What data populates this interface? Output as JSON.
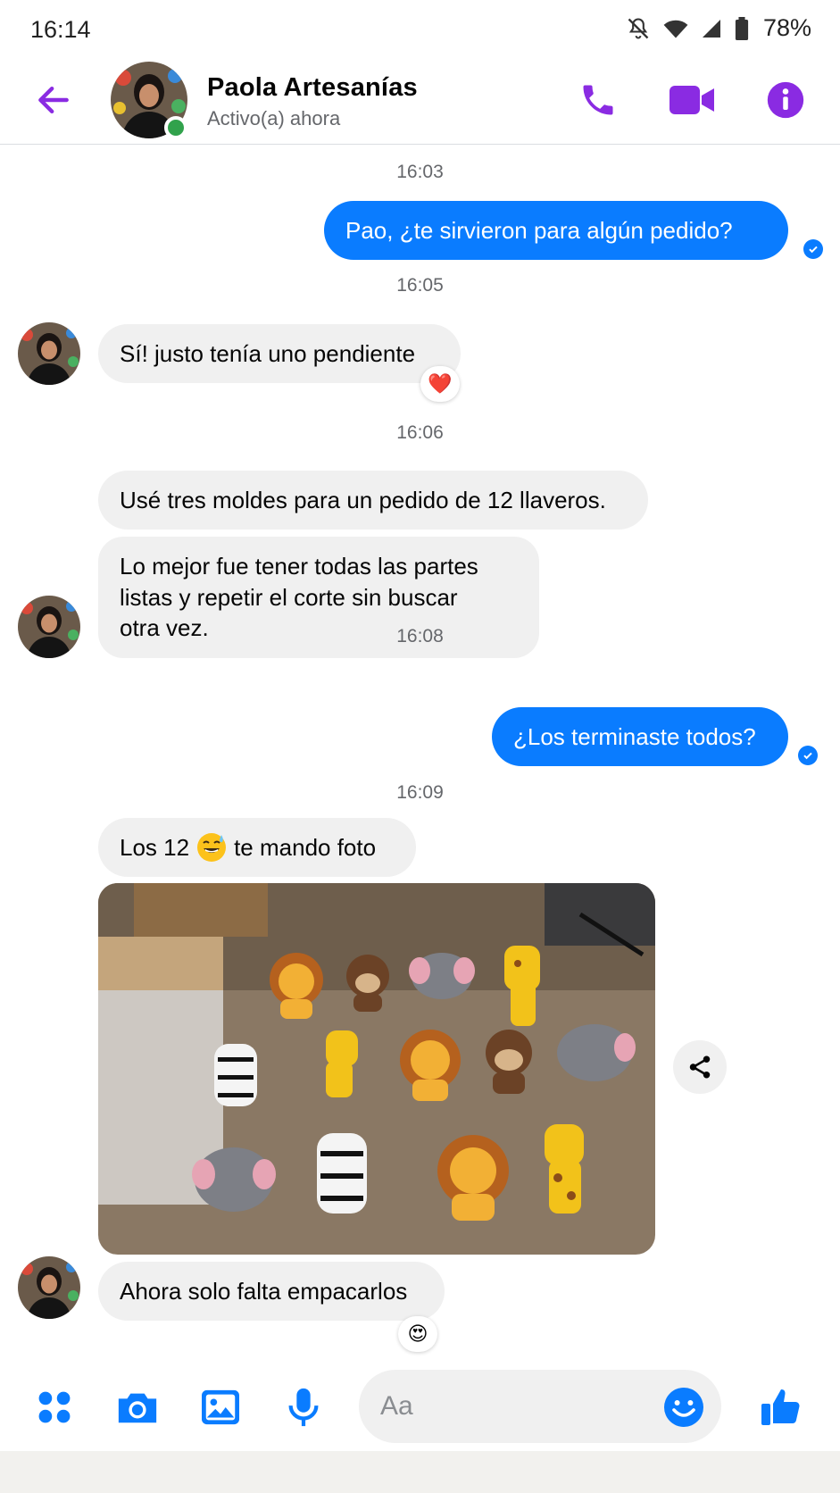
{
  "status_bar": {
    "time": "16:14",
    "battery": "78%",
    "icons": [
      "mute-icon",
      "wifi-icon",
      "signal-icon",
      "battery-icon"
    ]
  },
  "header": {
    "contact_name": "Paola Artesanías",
    "contact_status": "Activo(a) ahora",
    "accent_color": "#8a2be2",
    "icons": [
      "back-arrow-icon",
      "phone-icon",
      "video-camera-icon",
      "info-icon"
    ]
  },
  "chat": {
    "timestamps": [
      "16:03",
      "16:05",
      "16:06",
      "16:08",
      "16:09"
    ],
    "messages": [
      {
        "direction": "outgoing",
        "text": "Pao, ¿te sirvieron para algún pedido?"
      },
      {
        "direction": "incoming",
        "text": "Sí! justo tenía uno pendiente",
        "reaction": "❤️"
      },
      {
        "direction": "incoming",
        "text": "Usé tres moldes para un pedido de 12 llaveros."
      },
      {
        "direction": "incoming",
        "lines": [
          "Lo mejor fue tener todas las partes",
          "listas y repetir el corte sin buscar",
          "otra vez."
        ]
      },
      {
        "direction": "outgoing",
        "text": "¿Los terminaste todos?"
      },
      {
        "direction": "incoming",
        "text_before": "Los 12",
        "emoji": "grinning-sweat-emoji",
        "text_after": "te mando foto"
      },
      {
        "direction": "incoming",
        "type": "photo",
        "description_icon": "felt-keychains-photo"
      },
      {
        "direction": "incoming",
        "text": "Ahora solo falta empacarlos",
        "reaction": "😍"
      }
    ],
    "outgoing_color": "#0a7cff",
    "incoming_color": "#f0f0f0"
  },
  "composer": {
    "placeholder": "Aa",
    "icons": [
      "apps-grid-icon",
      "camera-icon",
      "gallery-icon",
      "microphone-icon",
      "emoji-icon",
      "thumbs-up-icon"
    ],
    "icon_color": "#0a7cff"
  }
}
